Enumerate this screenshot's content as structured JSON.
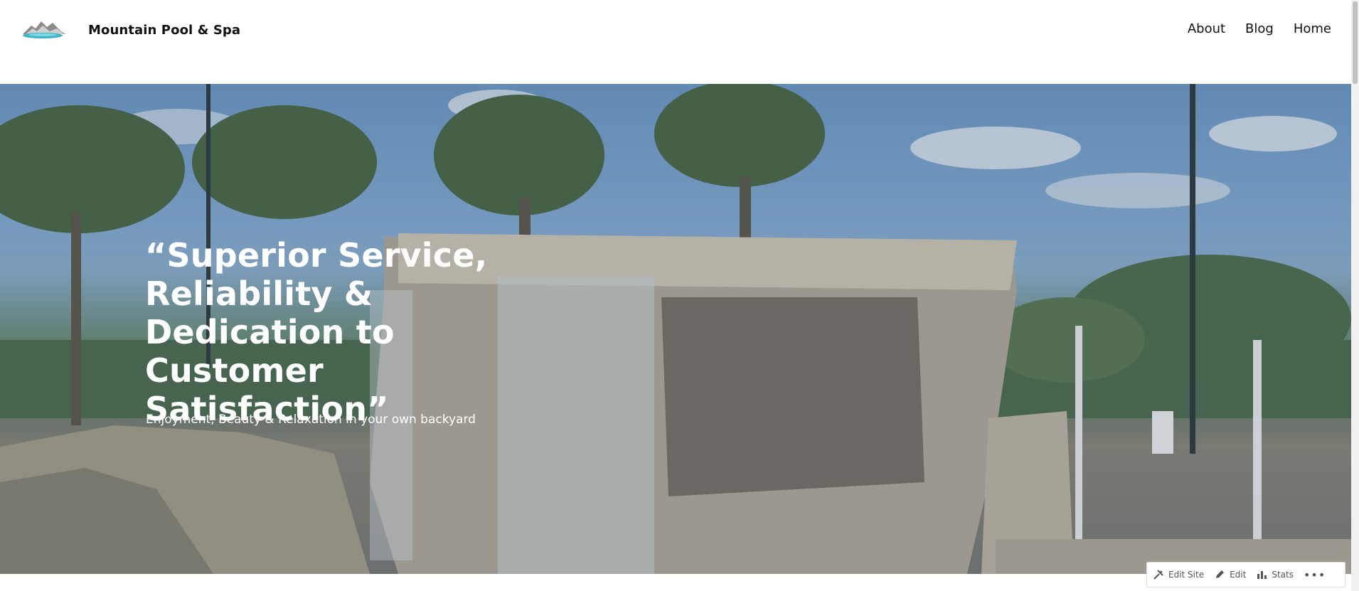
{
  "header": {
    "site_title": "Mountain Pool & Spa",
    "nav": [
      "About",
      "Blog",
      "Home"
    ]
  },
  "hero": {
    "heading": "“Superior Service, Reliability & Dedication to Customer Satisfaction”",
    "subheading": "Enjoyment, Beauty & Relaxation in your own backyard"
  },
  "admin_bar": {
    "edit_site": "Edit Site",
    "edit": "Edit",
    "stats": "Stats",
    "more": "•••"
  },
  "colors": {
    "text": "#111111",
    "hero_text": "#ffffff",
    "sky": "#86aed5"
  },
  "icons": [
    "logo-icon",
    "tools-icon",
    "pencil-icon",
    "stats-icon",
    "more-icon"
  ]
}
